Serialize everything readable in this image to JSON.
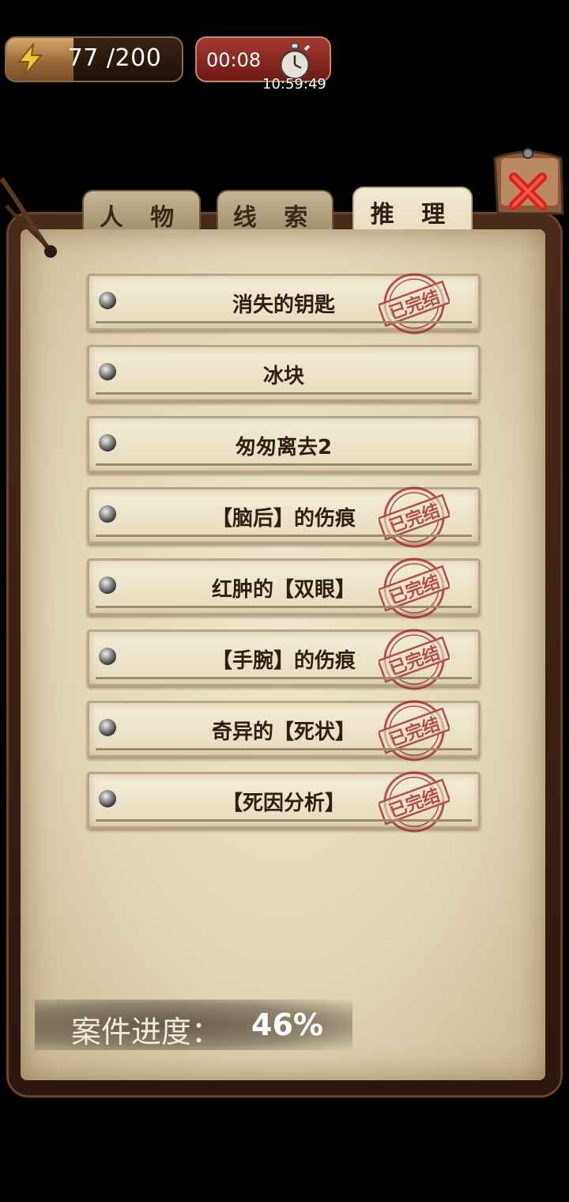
{
  "hud": {
    "energy_text": "77 /200",
    "energy_current": 77,
    "energy_max": 200,
    "timer_text": "00:08",
    "clock_text": "10:59:49"
  },
  "tabs": [
    {
      "label": "人 物",
      "active": false
    },
    {
      "label": "线 索",
      "active": false
    },
    {
      "label": "推 理",
      "active": true
    }
  ],
  "items": [
    {
      "label": "消失的钥匙",
      "completed": true
    },
    {
      "label": "冰块",
      "completed": false
    },
    {
      "label": "匆匆离去2",
      "completed": false
    },
    {
      "label": "【脑后】的伤痕",
      "completed": true
    },
    {
      "label": "红肿的【双眼】",
      "completed": true
    },
    {
      "label": "【手腕】的伤痕",
      "completed": true
    },
    {
      "label": "奇异的【死状】",
      "completed": true
    },
    {
      "label": "【死因分析】",
      "completed": true
    }
  ],
  "stamp_text": "已完结",
  "progress": {
    "label": "案件进度：",
    "value": "46%"
  },
  "colors": {
    "stamp": "#a3282a",
    "close_x": "#d8231f",
    "energy_fill": "#c08850",
    "timer_bg": "#8c2620"
  },
  "icons": {
    "energy": "lightning-bolt-icon",
    "timer": "stopwatch-icon",
    "close": "close-x-icon",
    "pin": "pushpin-icon"
  }
}
